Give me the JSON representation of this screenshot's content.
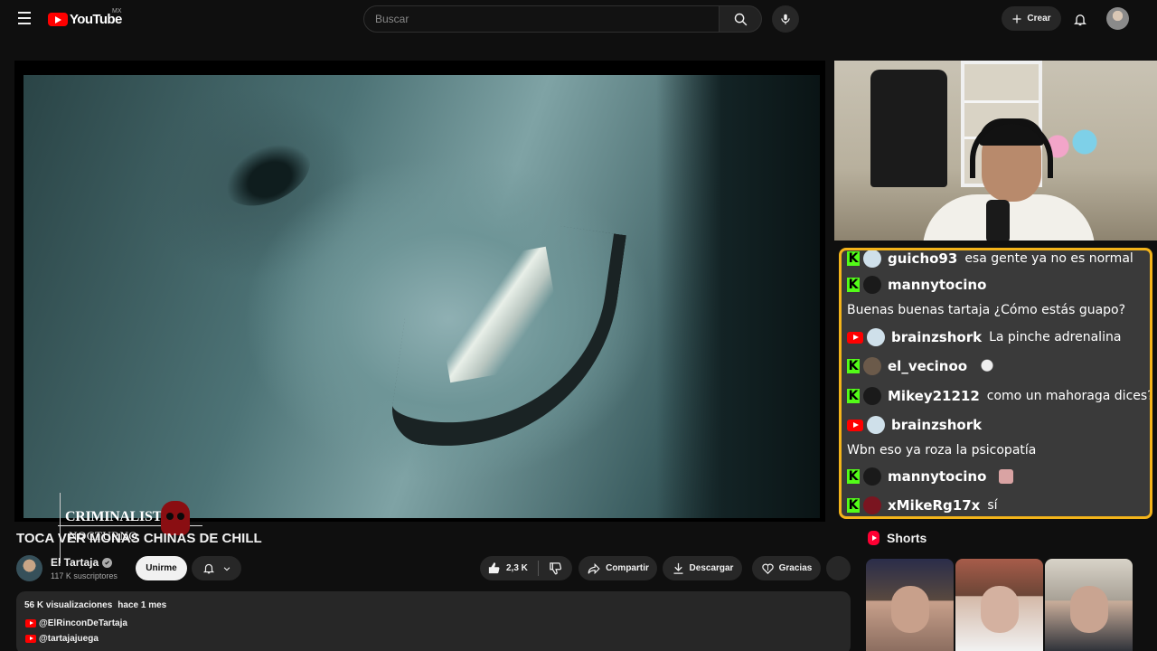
{
  "masthead": {
    "logo_text": "YouTube",
    "country_code": "MX",
    "search_placeholder": "Buscar",
    "create_label": "Crear"
  },
  "video": {
    "title": "TOCA VER MONAS CHINAS DE CHILL",
    "watermark_line1": "CRIMINALISTA",
    "watermark_line2": "NOCTURNO"
  },
  "chat": {
    "border_color": "#f4b41a",
    "messages": [
      {
        "platform": "kick",
        "user": "guicho93",
        "text": "esa gente ya no es normal"
      },
      {
        "platform": "kick",
        "user": "mannytocino",
        "text": ""
      },
      {
        "platform": "",
        "user": "",
        "text": "Buenas buenas tartaja ¿Cómo estás guapo?"
      },
      {
        "platform": "youtube",
        "user": "brainzshork",
        "text": "La pinche adrenalina"
      },
      {
        "platform": "kick",
        "user": "el_vecinoo",
        "text": ""
      },
      {
        "platform": "kick",
        "user": "Mikey21212",
        "text": "como un mahoraga dices?"
      },
      {
        "platform": "youtube",
        "user": "brainzshork",
        "text": ""
      },
      {
        "platform": "",
        "user": "",
        "text": "Wbn eso ya roza la psicopatía"
      },
      {
        "platform": "kick",
        "user": "mannytocino",
        "text": ""
      },
      {
        "platform": "kick",
        "user": "xMikeRg17x",
        "text": "sí"
      }
    ]
  },
  "channel": {
    "name": "El Tartaja",
    "subscribers": "117 K suscriptores",
    "join_label": "Unirme"
  },
  "actions": {
    "likes": "2,3 K",
    "share": "Compartir",
    "download": "Descargar",
    "thanks": "Gracias"
  },
  "description": {
    "views": "56 K visualizaciones",
    "date": "hace 1 mes",
    "links": [
      "@ElRinconDeTartaja",
      "@tartajajuega"
    ]
  },
  "shorts": {
    "heading": "Shorts"
  },
  "colors": {
    "accent_red": "#ff0000",
    "kick_green": "#53fc18"
  }
}
